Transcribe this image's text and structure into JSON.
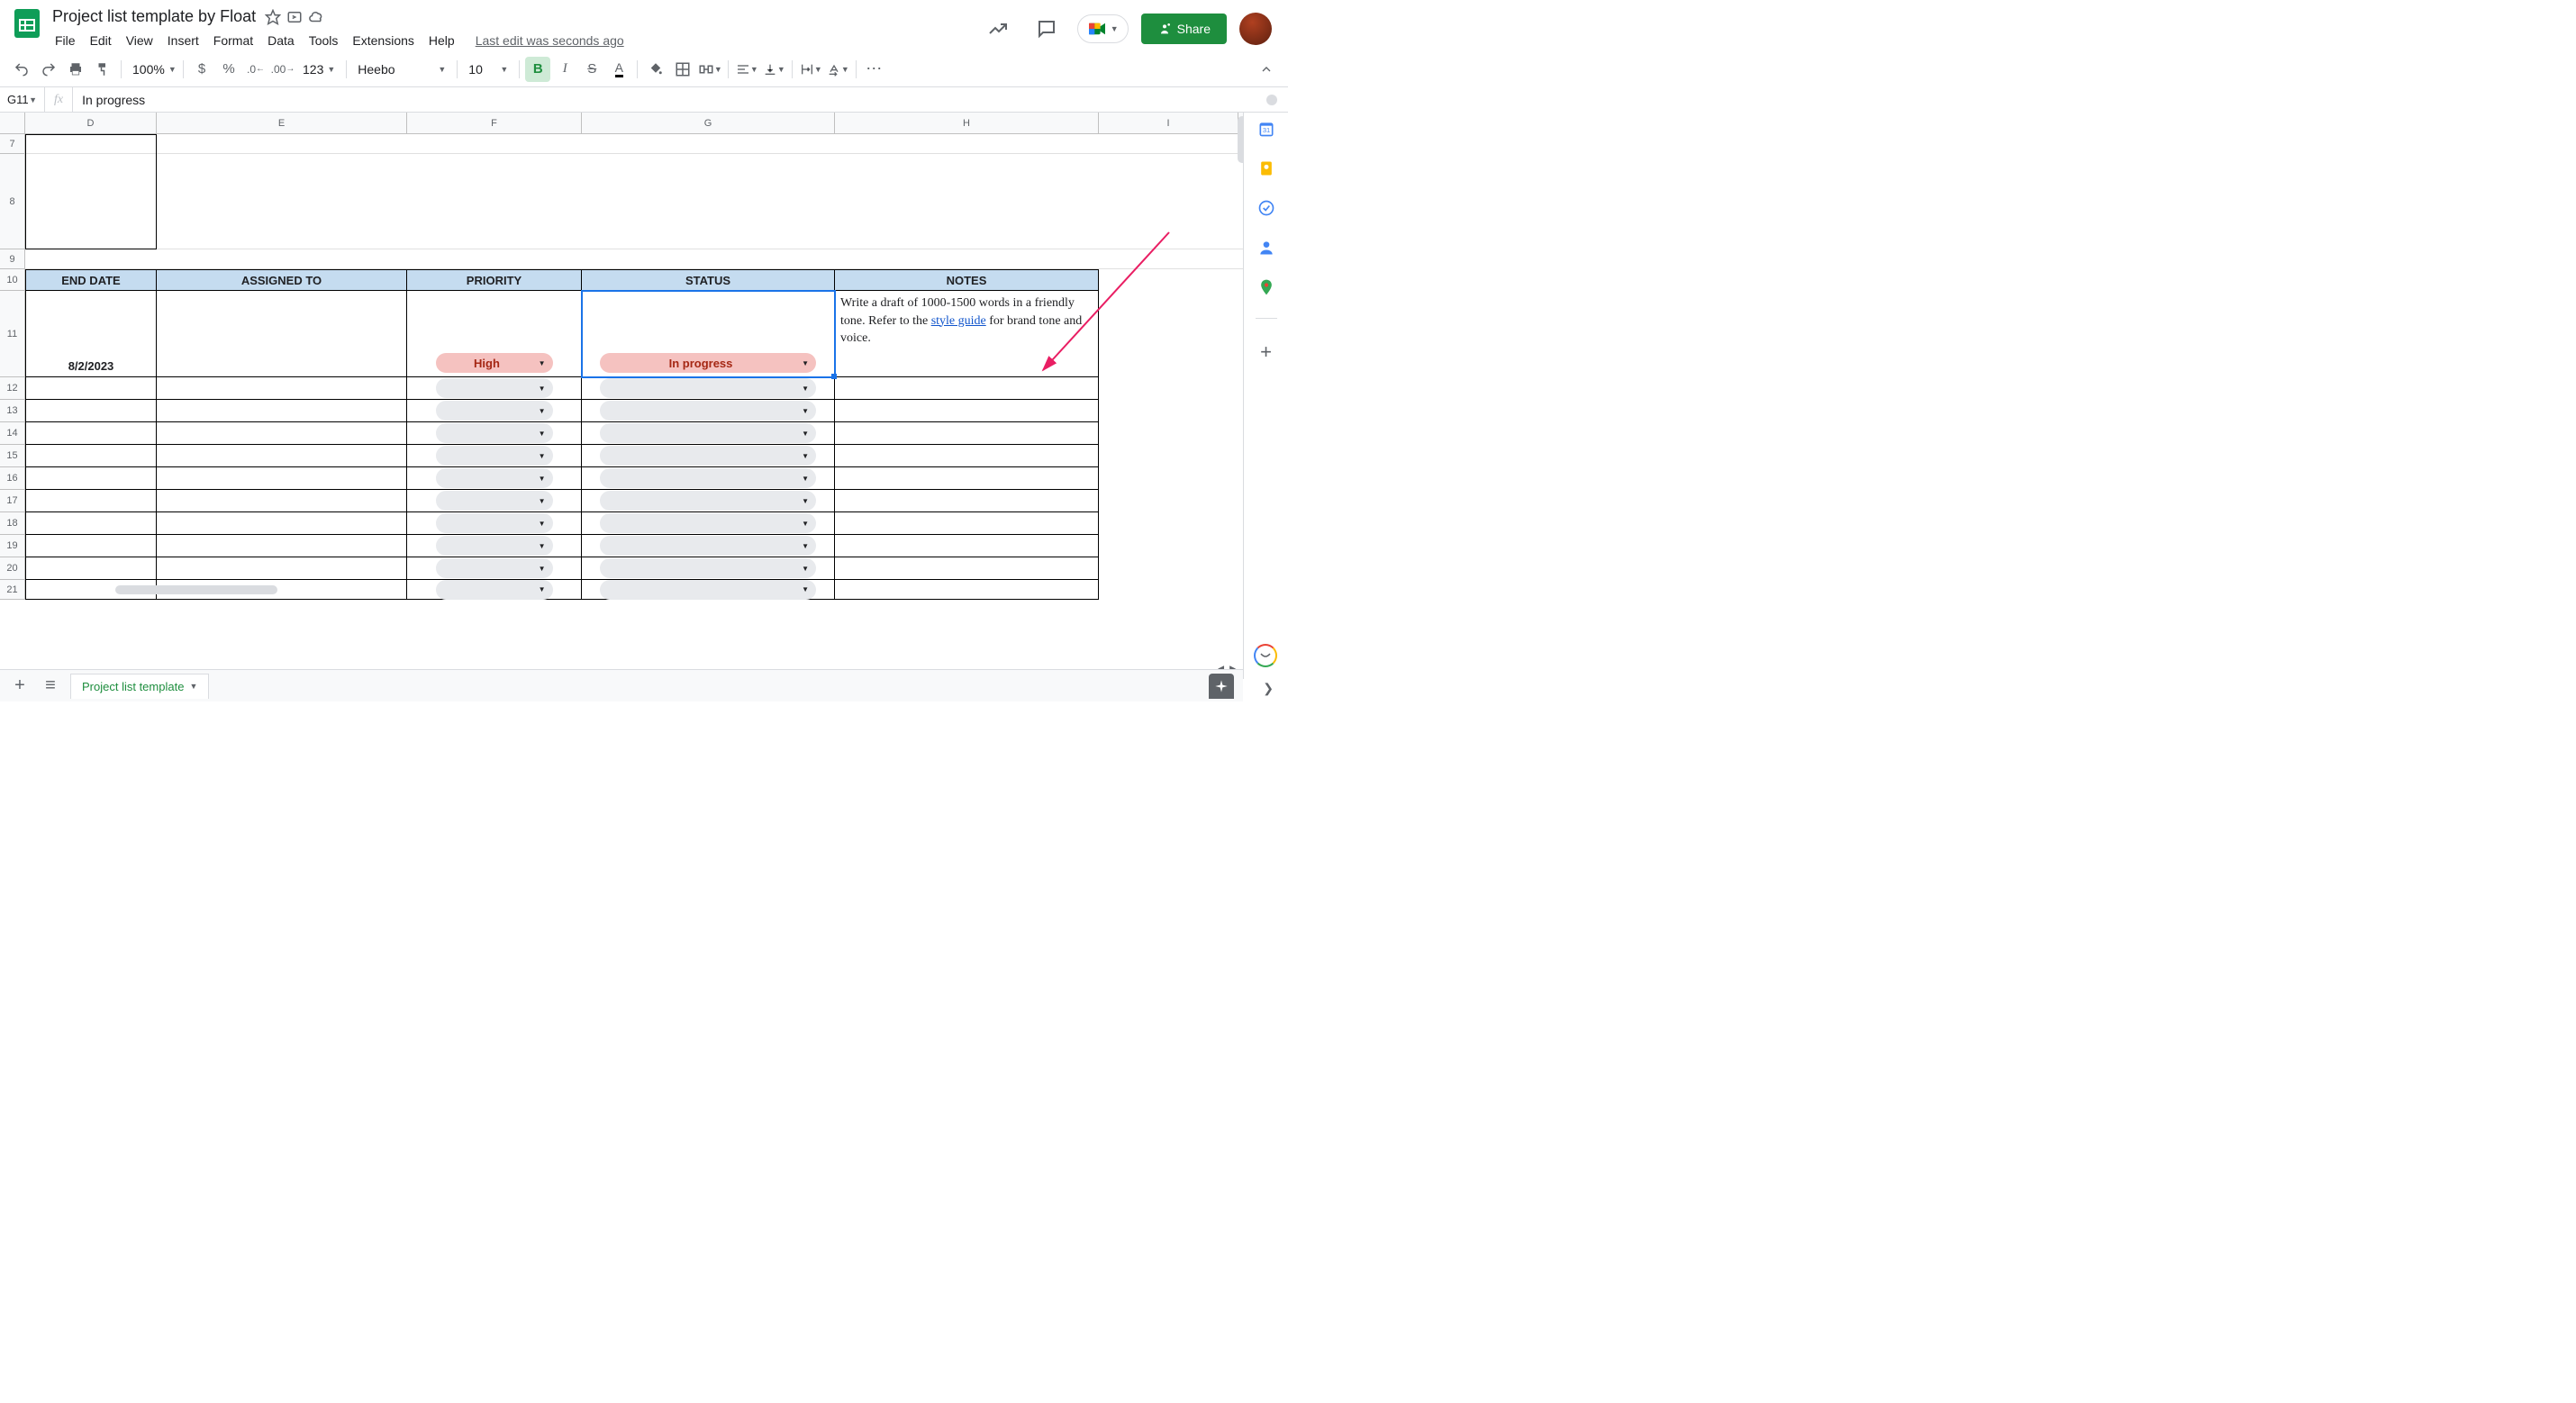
{
  "doc": {
    "title": "Project list template by Float",
    "last_edit": "Last edit was seconds ago"
  },
  "menu": {
    "file": "File",
    "edit": "Edit",
    "view": "View",
    "insert": "Insert",
    "format": "Format",
    "data": "Data",
    "tools": "Tools",
    "extensions": "Extensions",
    "help": "Help"
  },
  "share": {
    "label": "Share"
  },
  "toolbar": {
    "zoom": "100%",
    "format_number": "123",
    "font": "Heebo",
    "size": "10"
  },
  "namebox": {
    "cell": "G11",
    "formula": "In progress"
  },
  "columns": {
    "D": "D",
    "E": "E",
    "F": "F",
    "G": "G",
    "H": "H",
    "I": "I"
  },
  "row_labels": [
    "7",
    "8",
    "9",
    "10",
    "11",
    "12",
    "13",
    "14",
    "15",
    "16",
    "17",
    "18",
    "19",
    "20",
    "21"
  ],
  "headers": {
    "end_date": "END DATE",
    "assigned_to": "ASSIGNED TO",
    "priority": "PRIORITY",
    "status": "STATUS",
    "notes": "NOTES"
  },
  "row11": {
    "end_date": "8/2/2023",
    "priority": "High",
    "status": "In progress",
    "notes_pre": "Write a draft of 1000-1500 words in a friendly tone. Refer to the ",
    "notes_link": "style guide",
    "notes_post": " for brand tone and voice."
  },
  "sheet_tab": {
    "name": "Project list template"
  }
}
